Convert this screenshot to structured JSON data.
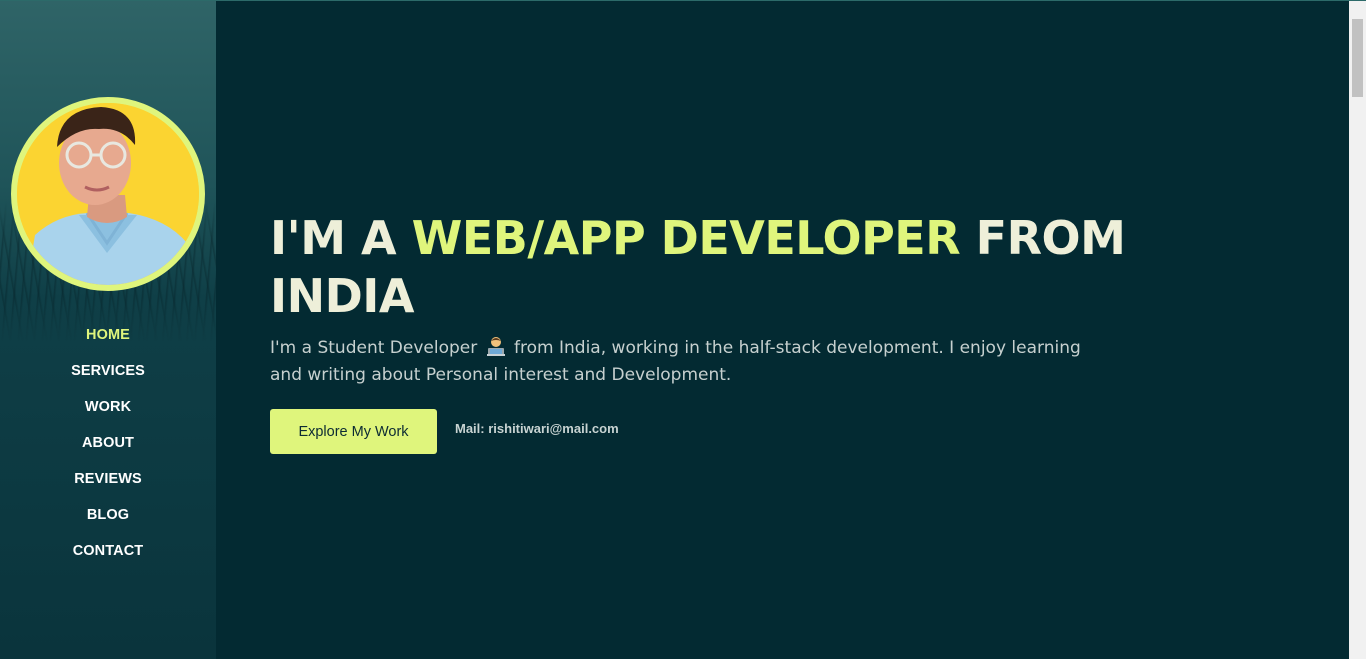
{
  "nav": {
    "items": [
      {
        "label": "HOME",
        "active": true
      },
      {
        "label": "SERVICES",
        "active": false
      },
      {
        "label": "WORK",
        "active": false
      },
      {
        "label": "ABOUT",
        "active": false
      },
      {
        "label": "REVIEWS",
        "active": false
      },
      {
        "label": "BLOG",
        "active": false
      },
      {
        "label": "CONTACT",
        "active": false
      }
    ]
  },
  "hero": {
    "title_prefix": "I'M A ",
    "title_accent": "WEB/APP DEVELOPER",
    "title_suffix": " FROM INDIA",
    "desc_before": "I'm a Student Developer ",
    "emoji": "technologist-emoji",
    "desc_after": " from India, working in the half-stack development. I enjoy learning and writing about Personal interest and Development.",
    "cta_label": "Explore My Work",
    "mail": "Mail: rishitiwari@mail.com"
  },
  "colors": {
    "accent": "#dff57c",
    "background": "#032a32",
    "title": "#eeefd9"
  }
}
